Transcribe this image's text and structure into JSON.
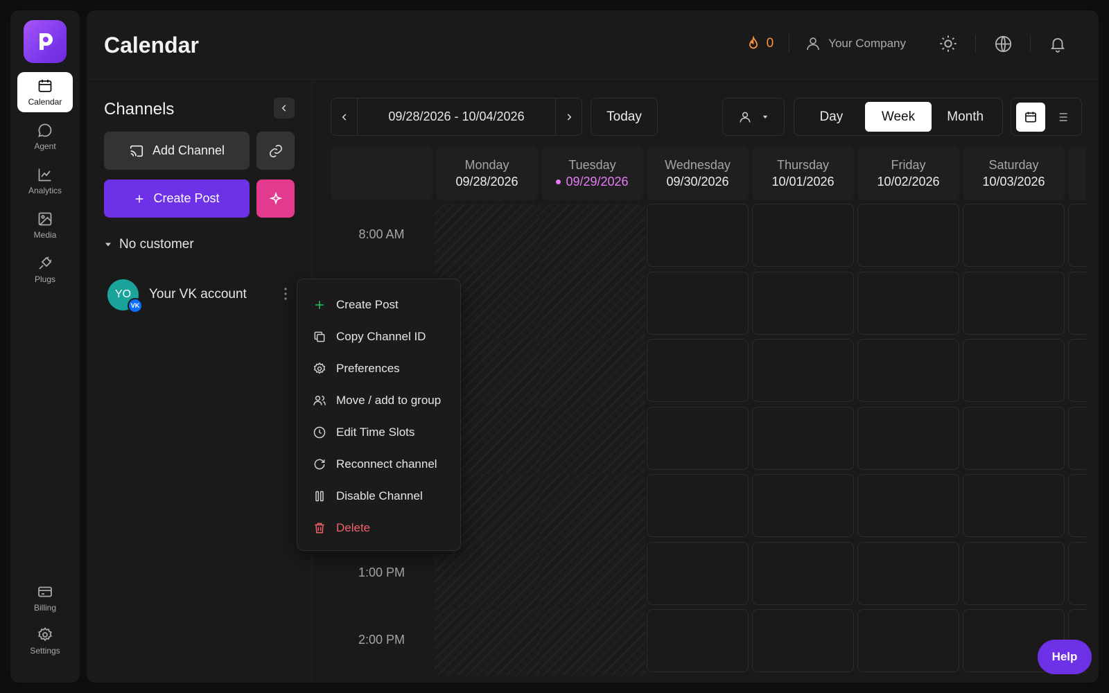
{
  "nav": {
    "items": [
      {
        "label": "Calendar",
        "icon": "calendar-icon",
        "active": true
      },
      {
        "label": "Agent",
        "icon": "chat-icon"
      },
      {
        "label": "Analytics",
        "icon": "chart-icon"
      },
      {
        "label": "Media",
        "icon": "image-icon"
      },
      {
        "label": "Plugs",
        "icon": "plug-icon"
      }
    ],
    "bottom_items": [
      {
        "label": "Billing",
        "icon": "credit-card-icon"
      },
      {
        "label": "Settings",
        "icon": "gear-icon"
      }
    ]
  },
  "header": {
    "title": "Calendar",
    "streak_count": "0",
    "company_label": "Your Company"
  },
  "channels": {
    "title": "Channels",
    "add_channel_label": "Add Channel",
    "create_post_label": "Create Post",
    "customer_label": "No customer",
    "account": {
      "initials": "YO",
      "badge": "VK",
      "name": "Your VK account",
      "avatar_color": "#1aa39a"
    }
  },
  "calendar": {
    "date_range": "09/28/2026 - 10/04/2026",
    "today_label": "Today",
    "views": [
      {
        "label": "Day"
      },
      {
        "label": "Week",
        "active": true
      },
      {
        "label": "Month"
      }
    ],
    "days": [
      {
        "name": "Monday",
        "date": "09/28/2026",
        "past": true
      },
      {
        "name": "Tuesday",
        "date": "09/29/2026",
        "today": true,
        "past": true
      },
      {
        "name": "Wednesday",
        "date": "09/30/2026"
      },
      {
        "name": "Thursday",
        "date": "10/01/2026"
      },
      {
        "name": "Friday",
        "date": "10/02/2026"
      },
      {
        "name": "Saturday",
        "date": "10/03/2026"
      }
    ],
    "visible_times": [
      {
        "row": 0,
        "label": "8:00 AM"
      },
      {
        "row": 5,
        "label": "1:00 PM"
      },
      {
        "row": 6,
        "label": "2:00 PM"
      }
    ],
    "row_count": 7
  },
  "context_menu": {
    "items": [
      {
        "label": "Create Post",
        "icon": "plus-icon"
      },
      {
        "label": "Copy Channel ID",
        "icon": "copy-icon"
      },
      {
        "label": "Preferences",
        "icon": "gear-icon"
      },
      {
        "label": "Move / add to group",
        "icon": "users-icon"
      },
      {
        "label": "Edit Time Slots",
        "icon": "clock-icon"
      },
      {
        "label": "Reconnect channel",
        "icon": "refresh-icon"
      },
      {
        "label": "Disable Channel",
        "icon": "pause-icon"
      },
      {
        "label": "Delete",
        "icon": "trash-icon",
        "danger": true
      }
    ]
  },
  "help_label": "Help",
  "colors": {
    "accent": "#6d31e8",
    "magic": "#e33a8d",
    "today": "#e879f9",
    "streak": "#fb923c",
    "danger": "#f0616d"
  }
}
